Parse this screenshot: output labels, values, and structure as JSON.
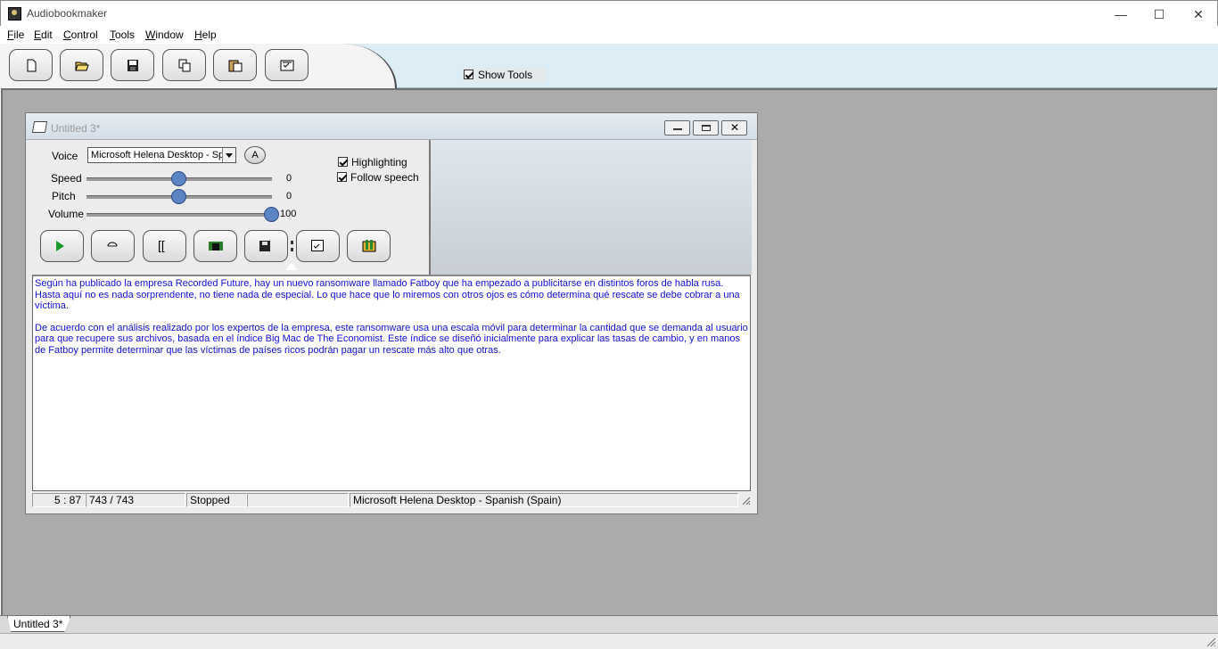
{
  "app": {
    "title": "Audiobookmaker"
  },
  "window_controls": {
    "minimize": "—",
    "maximize": "☐",
    "close": "✕"
  },
  "menu": [
    {
      "label": "File",
      "accel": "F",
      "rest": "ile"
    },
    {
      "label": "Edit",
      "accel": "E",
      "rest": "dit"
    },
    {
      "label": "Control",
      "accel": "C",
      "rest": "ontrol"
    },
    {
      "label": "Tools",
      "accel": "T",
      "rest": "ools"
    },
    {
      "label": "Window",
      "accel": "W",
      "rest": "indow"
    },
    {
      "label": "Help",
      "accel": "H",
      "rest": "elp"
    }
  ],
  "toolbar": {
    "buttons": [
      "new-file-icon",
      "open-folder-icon",
      "save-icon",
      "copy-icon",
      "paste-icon",
      "checklist-icon"
    ],
    "show_tools_label": "Show Tools",
    "show_tools_checked": true
  },
  "document": {
    "title": "Untitled 3*",
    "voice_label": "Voice",
    "voice_value": "Microsoft Helena Desktop - Spanish (Spain)",
    "voice_button": "A",
    "speed_label": "Speed",
    "speed_value": "0",
    "speed_level": 0.5,
    "pitch_label": "Pitch",
    "pitch_value": "0",
    "pitch_level": 0.5,
    "volume_label": "Volume",
    "volume_value": "100",
    "volume_level": 1.0,
    "highlighting_label": "Highlighting",
    "highlighting_checked": true,
    "follow_speech_label": "Follow speech",
    "follow_speech_checked": true,
    "text_paragraphs": [
      "Según ha publicado la empresa Recorded Future, hay un nuevo ransomware llamado Fatboy que ha empezado a publicitarse en distintos foros de habla rusa. Hasta aquí no es nada sorprendente, no tiene nada de especial. Lo que hace que lo miremos con otros ojos es cómo determina qué rescate se debe cobrar a una víctima.",
      "De acuerdo con el análisis realizado por los expertos de la empresa, este ransomware usa una escala móvil para determinar la cantidad que se demanda al usuario para que recupere sus archivos, basada en el índice Big Mac de The Economist. Este índice se diseñó inicialmente para explicar las tasas de cambio, y en manos de Fatboy permite determinar que las víctimas de países ricos podrán pagar un rescate más alto que otras."
    ],
    "status": {
      "position": "5 : 87",
      "chars": "743 / 743",
      "state": "Stopped",
      "empty": "",
      "voice": "Microsoft Helena Desktop - Spanish (Spain)"
    }
  },
  "tabs": [
    "Untitled 3*"
  ],
  "colors": {
    "text_blue": "#1010d8",
    "workspace": "#ababab",
    "slider_thumb": "#5b84c3"
  }
}
